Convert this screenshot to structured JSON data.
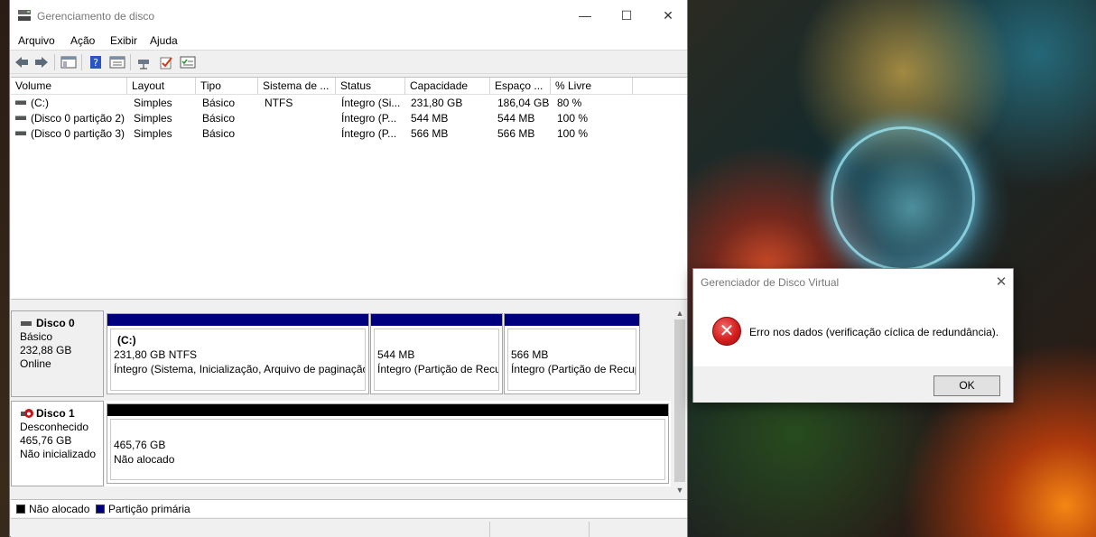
{
  "window": {
    "title": "Gerenciamento de disco",
    "controls": {
      "minimize": "—",
      "maximize": "☐",
      "close": "✕"
    }
  },
  "menu": [
    "Arquivo",
    "Ação",
    "Exibir",
    "Ajuda"
  ],
  "toolbar_icons": [
    "back-arrow-icon",
    "forward-arrow-icon",
    "console-tree-icon",
    "help-icon",
    "properties-icon",
    "connect-icon",
    "check-icon",
    "settings-icon"
  ],
  "volumes": {
    "columns": [
      "Volume",
      "Layout",
      "Tipo",
      "Sistema de ...",
      "Status",
      "Capacidade",
      "Espaço ...",
      "% Livre"
    ],
    "rows": [
      [
        "(C:)",
        "Simples",
        "Básico",
        "NTFS",
        "Íntegro (Si...",
        "231,80 GB",
        "186,04 GB",
        "80 %"
      ],
      [
        "(Disco 0 partição 2)",
        "Simples",
        "Básico",
        "",
        "Íntegro (P...",
        "544 MB",
        "544 MB",
        "100 %"
      ],
      [
        "(Disco 0 partição 3)",
        "Simples",
        "Básico",
        "",
        "Íntegro (P...",
        "566 MB",
        "566 MB",
        "100 %"
      ]
    ]
  },
  "disks": [
    {
      "name": "Disco 0",
      "lines": [
        "Básico",
        "232,88 GB",
        "Online"
      ],
      "partitions": [
        {
          "name": "(C:)",
          "size": "231,80 GB NTFS",
          "status": "Íntegro (Sistema, Inicialização, Arquivo de paginação"
        },
        {
          "name": "",
          "size": "544 MB",
          "status": "Íntegro (Partição de Recu"
        },
        {
          "name": "",
          "size": "566 MB",
          "status": "Íntegro (Partição de Recup"
        }
      ]
    },
    {
      "name": "Disco 1",
      "lines": [
        "Desconhecido",
        "465,76 GB",
        "Não inicializado"
      ],
      "partitions": [
        {
          "size": "465,76 GB",
          "status": "Não alocado"
        }
      ]
    }
  ],
  "legend": [
    {
      "label": "Não alocado",
      "color": "#000000"
    },
    {
      "label": "Partição primária",
      "color": "#00007f"
    }
  ],
  "dialog": {
    "title": "Gerenciador de Disco Virtual",
    "message": "Erro nos dados (verificação cíclica de redundância).",
    "ok_label": "OK",
    "close": "✕",
    "icon_glyph": "✕"
  },
  "colors": {
    "primary_partition": "#00007f",
    "unallocated": "#000000",
    "error_red": "#d41e1e"
  }
}
